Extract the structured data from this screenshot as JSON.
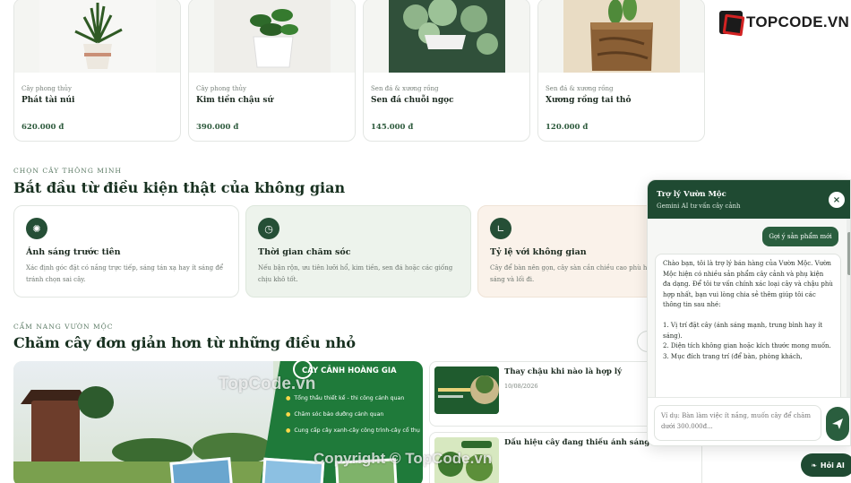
{
  "products": [
    {
      "category": "Cây phong thủy",
      "name": "Phát tài núi",
      "price": "620.000 đ"
    },
    {
      "category": "Cây phong thủy",
      "name": "Kim tiền chậu sứ",
      "price": "390.000 đ"
    },
    {
      "category": "Sen đá & xương rồng",
      "name": "Sen đá chuỗi ngọc",
      "price": "145.000 đ"
    },
    {
      "category": "Sen đá & xương rồng",
      "name": "Xương rồng tai thỏ",
      "price": "120.000 đ"
    }
  ],
  "logo": {
    "text": "TOPCODE.VN"
  },
  "smart_section": {
    "eyebrow": "CHỌN CÂY THÔNG MINH",
    "heading": "Bắt đầu từ điều kiện thật của không gian",
    "cards": [
      {
        "icon": "sun-icon",
        "title": "Ánh sáng trước tiên",
        "desc": "Xác định góc đặt có nắng trực tiếp, sáng tán xạ hay ít sáng để tránh chọn sai cây."
      },
      {
        "icon": "clock-icon",
        "title": "Thời gian chăm sóc",
        "desc": "Nếu bận rộn, ưu tiên lưỡi hổ, kim tiền, sen đá hoặc các giống chịu khô tốt."
      },
      {
        "icon": "ruler-icon",
        "title": "Tỷ lệ với không gian",
        "desc": "Cây để bàn nên gọn, cây sàn cần chiều cao phù hợp với ánh sáng và lối đi."
      }
    ]
  },
  "care_section": {
    "eyebrow": "CẨM NANG VƯỜN MỘC",
    "heading": "Chăm cây đơn giản hơn từ những điều nhỏ",
    "banner": {
      "brand": "CÂY CẢNH HOÀNG GIA",
      "lines": [
        "Tổng thầu thiết kế - thi công cảnh quan",
        "Chăm sóc bảo dưỡng cảnh quan",
        "Cung cấp cây xanh-cây công trình-cây cổ thụ"
      ]
    },
    "articles": [
      {
        "title": "Thay chậu khi nào là hợp lý",
        "date": "10/08/2026"
      },
      {
        "title": "Dấu hiệu cây đang thiếu ánh sáng",
        "date": ""
      }
    ]
  },
  "chat": {
    "title": "Trợ lý Vườn Mộc",
    "subtitle": "Gemini AI tư vấn cây cảnh",
    "user_message": "Gợi ý sản phẩm mới",
    "bot_message": "Chào bạn, tôi là trợ lý bán hàng của Vườn Mộc. Vườn Mộc hiện có nhiều sản phẩm cây cảnh và phụ kiện đa dạng. Để tôi tư vấn chính xác loại cây và chậu phù hợp nhất, bạn vui lòng chia sẻ thêm giúp tôi các thông tin sau nhé:\n\n1. Vị trí đặt cây (ánh sáng mạnh, trung bình hay ít sáng).\n2. Diện tích không gian hoặc kích thước mong muốn.\n3. Mục đích trang trí (để bàn, phòng khách,",
    "input_placeholder": "Ví dụ: Bàn làm việc ít nắng, muốn cây để chăm dưới 300.000đ...",
    "fab_label": "Hỏi AI"
  },
  "watermarks": [
    "TopCode.vn",
    "Copyright © TopCode.vn"
  ]
}
